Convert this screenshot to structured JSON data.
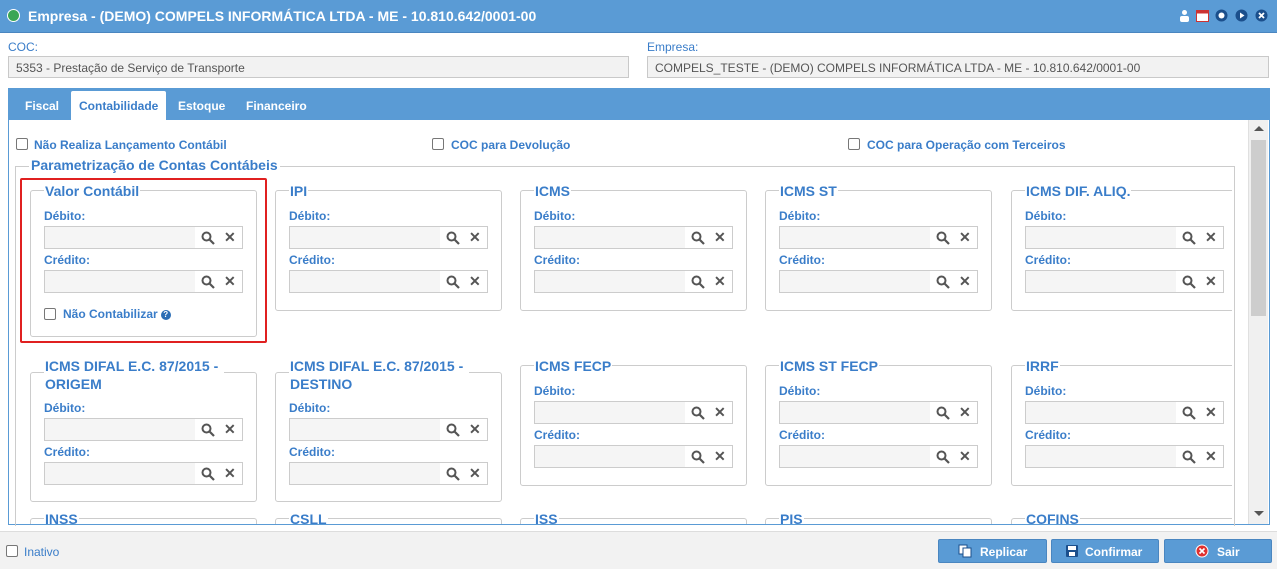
{
  "window": {
    "title": "Empresa - (DEMO) COMPELS INFORMÁTICA LTDA - ME - 10.810.642/0001-00",
    "title_icons": [
      "person-icon",
      "calendar-icon",
      "circle-icon",
      "play-icon",
      "close-icon"
    ]
  },
  "coc": {
    "label": "COC:",
    "value": "5353 - Prestação de Serviço de Transporte"
  },
  "empresa": {
    "label": "Empresa:",
    "value": "COMPELS_TESTE - (DEMO) COMPELS INFORMÁTICA LTDA - ME - 10.810.642/0001-00"
  },
  "tabs": [
    {
      "label": "Fiscal",
      "active": false
    },
    {
      "label": "Contabilidade",
      "active": true
    },
    {
      "label": "Estoque",
      "active": false
    },
    {
      "label": "Financeiro",
      "active": false
    }
  ],
  "options": {
    "nao_realiza": "Não Realiza Lançamento Contábil",
    "coc_devolucao": "COC para Devolução",
    "coc_terceiros": "COC para Operação com Terceiros"
  },
  "section": {
    "title": "Parametrização de Contas Contábeis"
  },
  "field_labels": {
    "debito": "Débito:",
    "credito": "Crédito:"
  },
  "nao_contabilizar": "Não Contabilizar",
  "cards": [
    {
      "title": "Valor Contábil"
    },
    {
      "title": "IPI"
    },
    {
      "title": "ICMS"
    },
    {
      "title": "ICMS ST"
    },
    {
      "title": "ICMS DIF. ALIQ."
    },
    {
      "title": "ICMS DIFAL E.C. 87/2015 - ORIGEM"
    },
    {
      "title": "ICMS DIFAL E.C. 87/2015 - DESTINO"
    },
    {
      "title": "ICMS FECP"
    },
    {
      "title": "ICMS ST FECP"
    },
    {
      "title": "IRRF"
    },
    {
      "title": "INSS"
    },
    {
      "title": "CSLL"
    },
    {
      "title": "ISS"
    },
    {
      "title": "PIS"
    },
    {
      "title": "COFINS"
    }
  ],
  "footer": {
    "inativo": "Inativo",
    "replicar": "Replicar",
    "confirmar": "Confirmar",
    "sair": "Sair"
  },
  "colors": {
    "accent": "#5a9bd5",
    "label": "#3a7dc9",
    "highlight": "#e02020"
  }
}
